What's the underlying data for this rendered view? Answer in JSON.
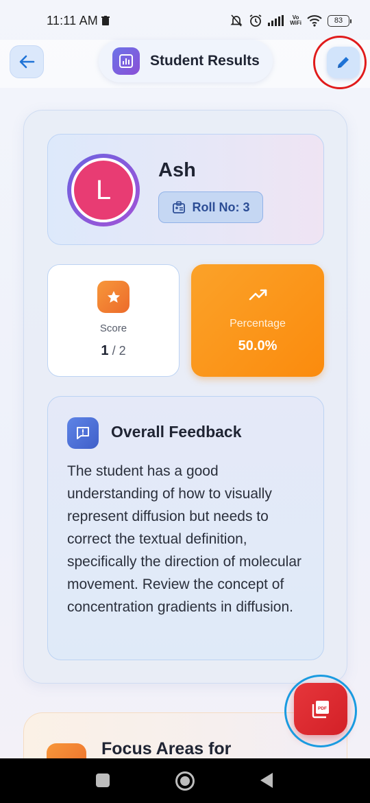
{
  "status_bar": {
    "time": "11:11 AM",
    "vo_label": "Vo",
    "wifi_label": "WiFi",
    "battery": "83"
  },
  "header": {
    "title": "Student Results"
  },
  "profile": {
    "avatar_letter": "L",
    "name": "Ash",
    "roll_label": "Roll No: 3"
  },
  "score": {
    "label": "Score",
    "obtained": "1",
    "total": "/ 2"
  },
  "percentage": {
    "label": "Percentage",
    "value": "50.0%"
  },
  "feedback": {
    "title": "Overall Feedback",
    "text": "The student has a good understanding of how to visually represent diffusion but needs to correct the textual definition, specifically the direction of molecular movement. Review the concept of concentration gradients in diffusion."
  },
  "focus": {
    "title": "Focus Areas for"
  },
  "fab": {
    "label": "PDF"
  },
  "colors": {
    "accent_blue": "#1f73d6",
    "pdf_red": "#d32027",
    "percentage_orange": "#fb8b0d",
    "avatar_pink": "#e83c73"
  },
  "icons": [
    "back-arrow-icon",
    "chart-icon",
    "pencil-icon",
    "badge-icon",
    "star-icon",
    "trending-up-icon",
    "feedback-icon",
    "pdf-icon"
  ]
}
